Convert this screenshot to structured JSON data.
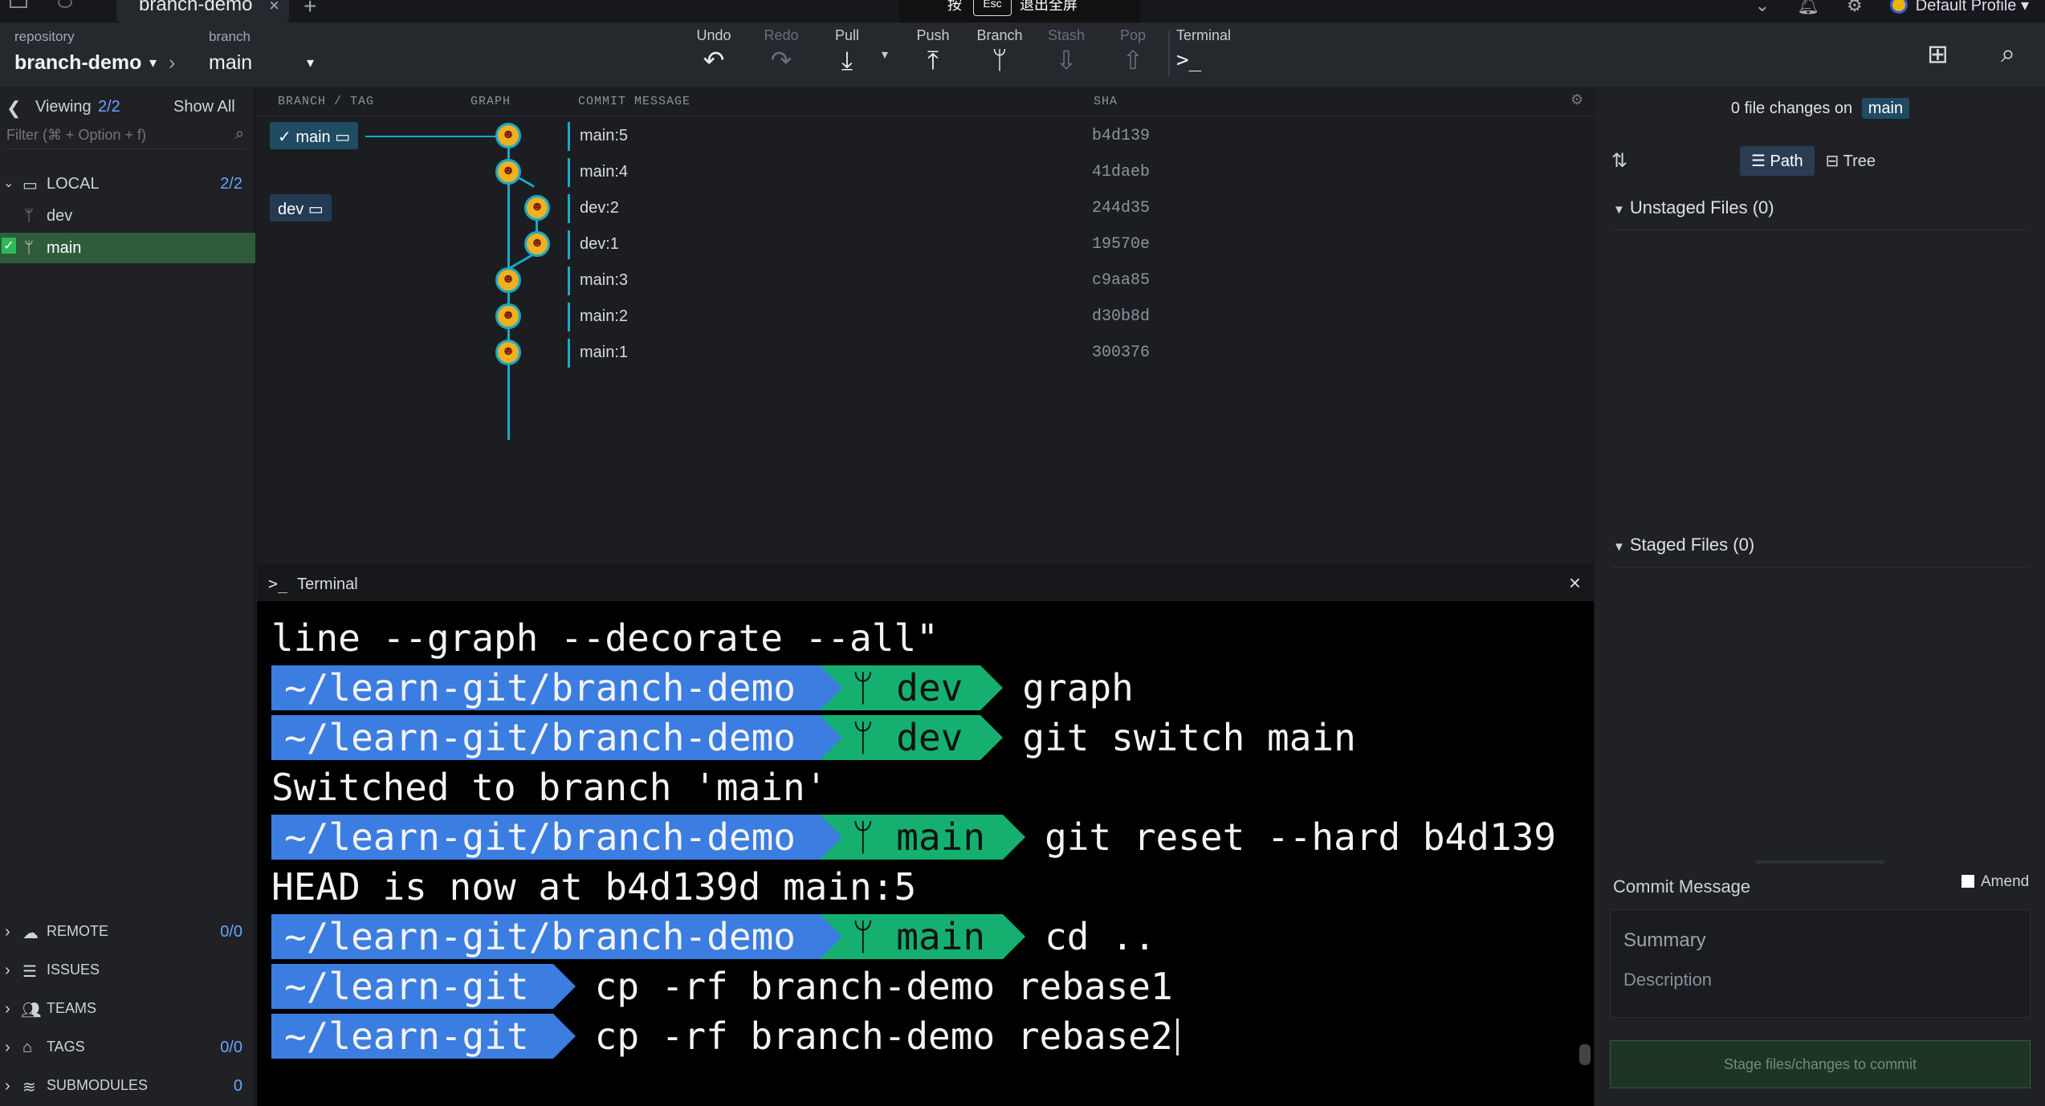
{
  "tabbar": {
    "tab_label": "branch-demo",
    "close": "×",
    "plus": "+",
    "esc_hint_pre": "按",
    "esc_key": "Esc",
    "esc_hint_post": "退出全屏",
    "profile": "Default Profile"
  },
  "toolbar": {
    "repo_label": "repository",
    "repo_value": "branch-demo",
    "branch_label": "branch",
    "branch_value": "main",
    "undo": "Undo",
    "redo": "Redo",
    "pull": "Pull",
    "push": "Push",
    "branch": "Branch",
    "stash": "Stash",
    "pop": "Pop",
    "terminal": "Terminal"
  },
  "left": {
    "viewing_label": "Viewing",
    "viewing_count": "2/2",
    "show_all": "Show All",
    "filter_placeholder": "Filter (⌘ + Option + f)",
    "local_label": "LOCAL",
    "local_count": "2/2",
    "branches": [
      "dev",
      "main"
    ],
    "remote_label": "REMOTE",
    "remote_count": "0/0",
    "issues_label": "ISSUES",
    "teams_label": "TEAMS",
    "tags_label": "TAGS",
    "tags_count": "0/0",
    "submodules_label": "SUBMODULES",
    "submodules_count": "0"
  },
  "graph": {
    "col_branch": "BRANCH / TAG",
    "col_graph": "GRAPH",
    "col_message": "COMMIT MESSAGE",
    "col_sha": "SHA",
    "ref_main": "main",
    "ref_dev": "dev",
    "commits": [
      {
        "msg": "main:5",
        "sha": "b4d139"
      },
      {
        "msg": "main:4",
        "sha": "41daeb"
      },
      {
        "msg": "dev:2",
        "sha": "244d35"
      },
      {
        "msg": "dev:1",
        "sha": "19570e"
      },
      {
        "msg": "main:3",
        "sha": "c9aa85"
      },
      {
        "msg": "main:2",
        "sha": "d30b8d"
      },
      {
        "msg": "main:1",
        "sha": "300376"
      }
    ]
  },
  "terminal": {
    "title": "Terminal",
    "close": "×",
    "line1": "line --graph --decorate --all\"",
    "path_full": "~/learn-git/branch-demo",
    "path_short": "~/learn-git",
    "branch_dev": "dev",
    "branch_main": "main",
    "cmd_graph": "graph",
    "cmd_switch": "git switch main",
    "out_switched": "Switched to branch 'main'",
    "cmd_reset": "git reset --hard b4d139",
    "out_head": "HEAD is now at b4d139d main:5",
    "cmd_cd": "cd ..",
    "cmd_cp1": "cp -rf branch-demo rebase1",
    "cmd_cp2": "cp -rf branch-demo rebase2"
  },
  "right": {
    "changes_text": "0 file changes on",
    "branch_badge": "main",
    "path_btn": "Path",
    "tree_btn": "Tree",
    "unstaged": "Unstaged Files (0)",
    "staged": "Staged Files (0)",
    "commit_message": "Commit Message",
    "amend": "Amend",
    "summary": "Summary",
    "description": "Description",
    "stage_btn": "Stage files/changes to commit"
  }
}
